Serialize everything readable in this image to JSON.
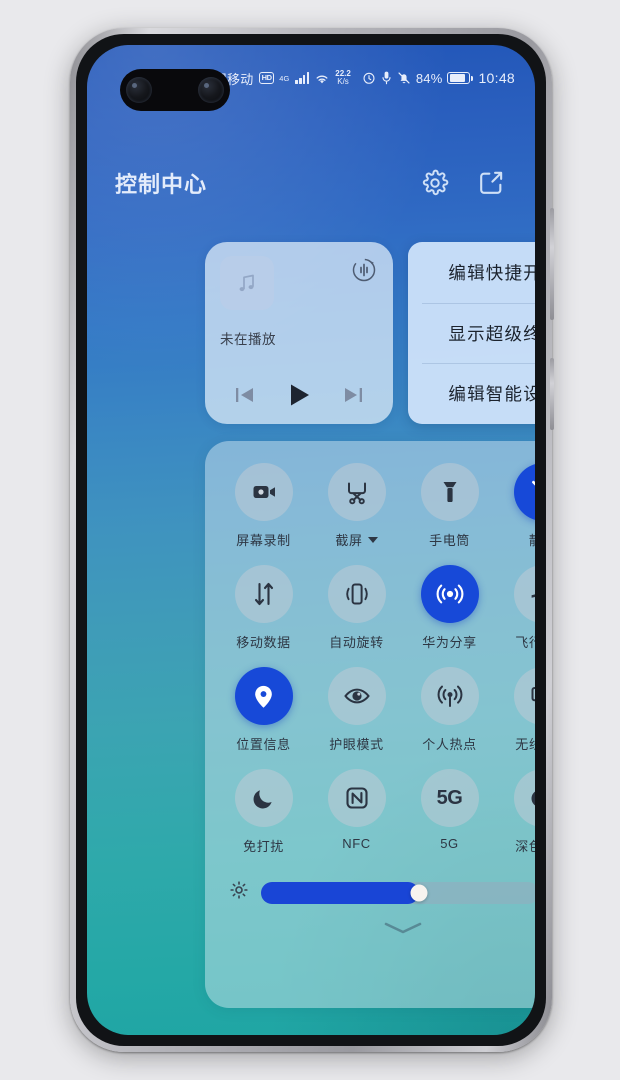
{
  "status_bar": {
    "carrier": "中国移动",
    "hd_badge": "HD",
    "signal_sup": "4G",
    "net_speed_value": "22.2",
    "net_speed_unit": "K/s",
    "battery_percent": "84%",
    "battery_level": 84,
    "clock": "10:48",
    "icons": [
      "volte-hd-icon",
      "signal-bars-icon",
      "wifi-icon",
      "alarm-icon",
      "microphone-icon",
      "mute-bell-icon",
      "battery-icon"
    ]
  },
  "header": {
    "title": "控制中心",
    "settings_icon": "gear-icon",
    "edit_icon": "edit-square-icon"
  },
  "media_card": {
    "album_icon": "music-note-icon",
    "cast_icon": "audio-cast-icon",
    "status_text": "未在播放",
    "prev_icon": "previous-track-icon",
    "play_icon": "play-icon",
    "next_icon": "next-track-icon"
  },
  "popup_menu": {
    "items": [
      {
        "label": "编辑快捷开关"
      },
      {
        "label": "显示超级终端"
      },
      {
        "label": "编辑智能设备"
      }
    ],
    "cursor": "mouse-cursor-arrow",
    "cursor_color": "#f5161a"
  },
  "toggles": {
    "active_color": "#1749d8",
    "rows": [
      [
        {
          "label": "屏幕录制",
          "icon": "screen-record-icon",
          "active": false,
          "has_caret": false
        },
        {
          "label": "截屏",
          "icon": "screenshot-icon",
          "active": false,
          "has_caret": true
        },
        {
          "label": "手电筒",
          "icon": "flashlight-icon",
          "active": false,
          "has_caret": false
        },
        {
          "label": "静音",
          "icon": "mute-bell-icon",
          "active": true,
          "has_caret": false
        }
      ],
      [
        {
          "label": "移动数据",
          "icon": "mobile-data-icon",
          "active": false,
          "has_caret": false
        },
        {
          "label": "自动旋转",
          "icon": "auto-rotate-icon",
          "active": false,
          "has_caret": false
        },
        {
          "label": "华为分享",
          "icon": "huawei-share-icon",
          "active": true,
          "has_caret": false
        },
        {
          "label": "飞行模式",
          "icon": "airplane-icon",
          "active": false,
          "has_caret": false
        }
      ],
      [
        {
          "label": "位置信息",
          "icon": "location-pin-icon",
          "active": true,
          "has_caret": false
        },
        {
          "label": "护眼模式",
          "icon": "eye-comfort-icon",
          "active": false,
          "has_caret": false
        },
        {
          "label": "个人热点",
          "icon": "hotspot-icon",
          "active": false,
          "has_caret": false
        },
        {
          "label": "无线投屏",
          "icon": "wireless-cast-icon",
          "active": false,
          "has_caret": false
        }
      ],
      [
        {
          "label": "免打扰",
          "icon": "moon-icon",
          "active": false,
          "has_caret": false
        },
        {
          "label": "NFC",
          "icon": "nfc-icon",
          "active": false,
          "has_caret": false
        },
        {
          "label": "5G",
          "icon": "5g-text-icon",
          "active": false,
          "has_caret": false,
          "glyph": "5G"
        },
        {
          "label": "深色模式",
          "icon": "dark-mode-icon",
          "active": false,
          "has_caret": false
        }
      ]
    ]
  },
  "brightness": {
    "low_icon": "brightness-low-icon",
    "high_icon": "brightness-high-icon",
    "value_percent": 57
  },
  "panel_footer": {
    "chevron_icon": "chevron-down-icon"
  }
}
